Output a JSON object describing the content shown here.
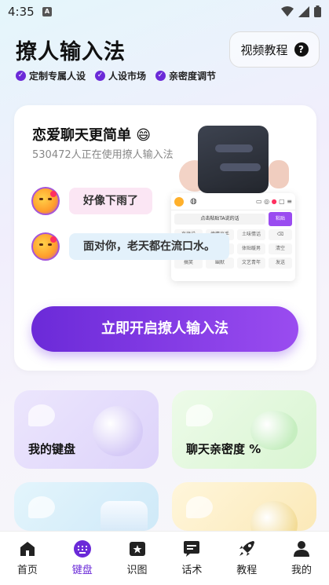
{
  "status_bar": {
    "time": "4:35",
    "notification_letter": "A"
  },
  "header": {
    "title": "撩人输入法",
    "features": [
      "定制专属人设",
      "人设市场",
      "亲密度调节"
    ],
    "video_button": {
      "label": "视频教程",
      "icon": "question-icon"
    }
  },
  "main_card": {
    "title": "恋爱聊天更简单 😄",
    "subtitle": "530472人正在使用撩人输入法",
    "chats": [
      "好像下雨了",
      "面对你，老天都在流口水。"
    ],
    "keyboard_preview": {
      "input_text": "点击粘贴TA说的话",
      "paste_label": "粘贴",
      "suggestions": [
        "直接说",
        "撩情高手",
        "土味情话",
        "体贴",
        "文艺",
        "体贴暖男",
        "搞笑",
        "幽默",
        "文艺青年"
      ],
      "side_label": "清空",
      "send_label": "发送"
    },
    "cta_label": "立即开启撩人输入法"
  },
  "tiles": [
    {
      "label": "我的键盘",
      "color": "#e9e2fb"
    },
    {
      "label": "聊天亲密度 %",
      "color": "#e6f8e2"
    },
    {
      "label": "",
      "color": "#dff1fb"
    },
    {
      "label": "",
      "color": "#fdf3d6"
    }
  ],
  "bottom_nav": {
    "items": [
      {
        "label": "首页",
        "icon": "home-icon"
      },
      {
        "label": "键盘",
        "icon": "keyboard-icon",
        "active": true
      },
      {
        "label": "识图",
        "icon": "image-recognition-icon"
      },
      {
        "label": "话术",
        "icon": "chat-script-icon"
      },
      {
        "label": "教程",
        "icon": "rocket-icon"
      },
      {
        "label": "我的",
        "icon": "profile-icon"
      }
    ]
  },
  "colors": {
    "accent": "#6b2ad8",
    "accent_light": "#9a4cf0"
  }
}
